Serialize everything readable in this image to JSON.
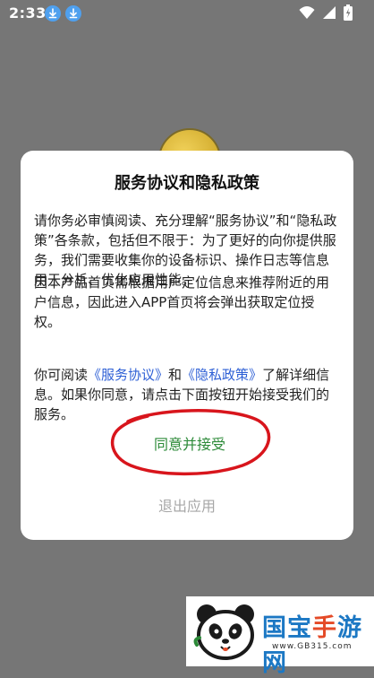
{
  "status_bar": {
    "time": "2:33",
    "notification_icons": [
      "download-icon",
      "download-icon"
    ],
    "system_icons": [
      "wifi-icon",
      "cellular-signal-icon",
      "battery-icon"
    ]
  },
  "dialog": {
    "title": "服务协议和隐私政策",
    "paragraph1": "请你务必审慎阅读、充分理解“服务协议”和“隐私政策”各条款，包括但不限于：为了更好的向你提供服务，我们需要收集你的设备标识、操作日志等信息用于分析、优化应用性能。",
    "paragraph2": "因本产品首页需根据用户定位信息来推荐附近的用户信息，因此进入APP首页将会弹出获取定位授权。",
    "paragraph3": {
      "prefix": "你可阅读",
      "service_link": "《服务协议》",
      "connector": "和",
      "privacy_link": "《隐私政策》",
      "suffix": "了解详细信息。如果你同意，请点击下面按钮开始接受我们的服务。"
    },
    "agree_label": "同意并接受",
    "exit_label": "退出应用"
  },
  "watermark": {
    "name_part1": "国宝",
    "name_part2": "手",
    "name_part3": "游网",
    "url": "www.GB315.com"
  },
  "colors": {
    "overlay": "#767676",
    "link": "#2d5fd5",
    "agree": "#2c8a38",
    "exit": "#a7a7a7",
    "annotation": "#d8151c",
    "status_icon_bg": "#4fa0ee"
  }
}
